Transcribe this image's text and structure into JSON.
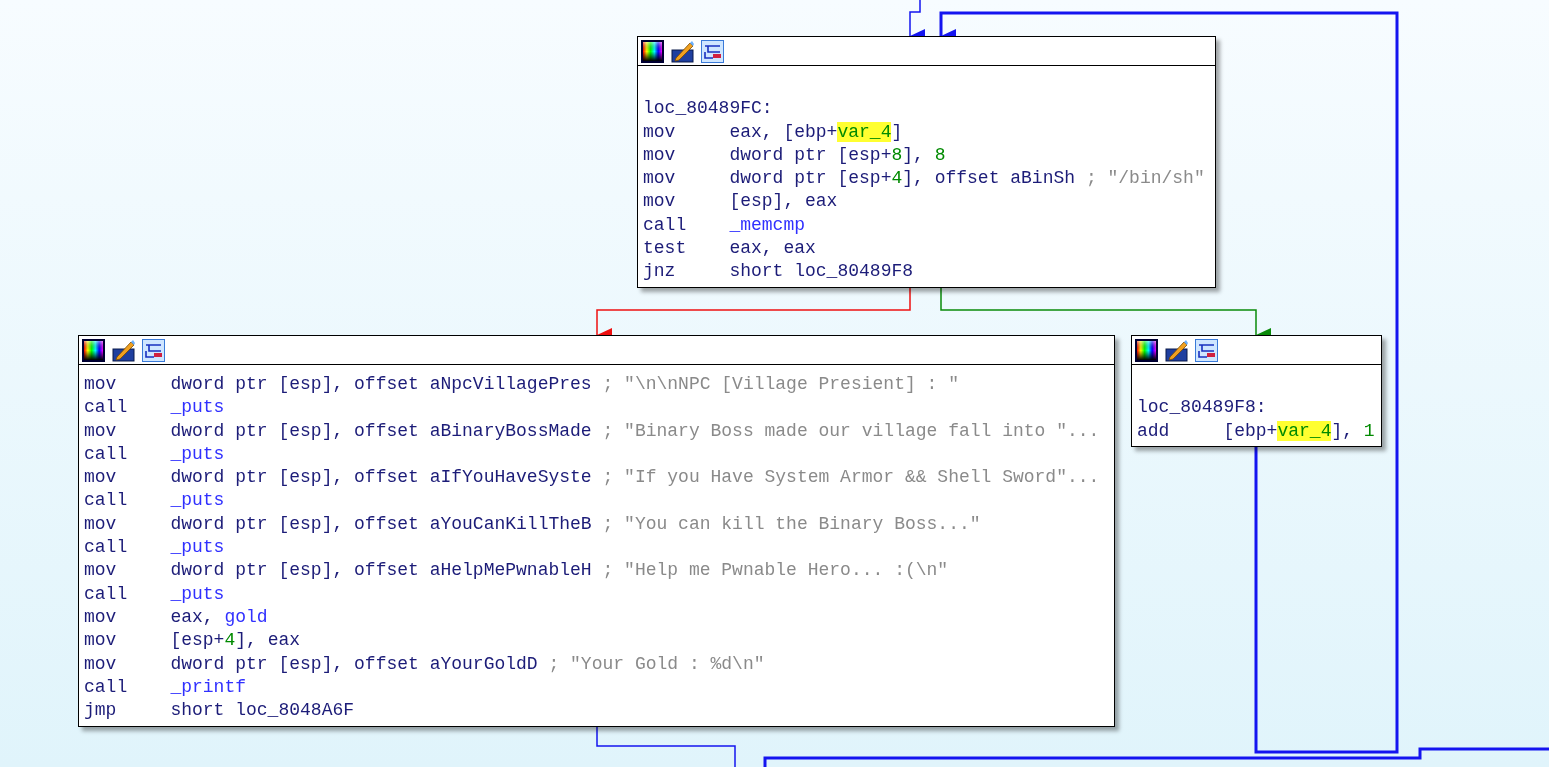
{
  "nodes": [
    {
      "lines": [
        {
          "kind": "blank"
        },
        {
          "kind": "label",
          "text": "loc_80489FC:"
        },
        {
          "kind": "instr",
          "mnemonic": "mov",
          "operands": [
            {
              "kind": "plain",
              "text": "eax, [ebp+"
            },
            {
              "kind": "var",
              "text": "var_4"
            },
            {
              "kind": "plain",
              "text": "]"
            }
          ]
        },
        {
          "kind": "instr",
          "mnemonic": "mov",
          "operands": [
            {
              "kind": "plain",
              "text": "dword ptr [esp+"
            },
            {
              "kind": "num",
              "text": "8"
            },
            {
              "kind": "plain",
              "text": "], "
            },
            {
              "kind": "num",
              "text": "8"
            }
          ]
        },
        {
          "kind": "instr",
          "mnemonic": "mov",
          "operands": [
            {
              "kind": "plain",
              "text": "dword ptr [esp+"
            },
            {
              "kind": "num",
              "text": "4"
            },
            {
              "kind": "plain",
              "text": "], offset aBinSh"
            }
          ],
          "comment": "; \"/bin/sh\""
        },
        {
          "kind": "instr",
          "mnemonic": "mov",
          "operands": [
            {
              "kind": "plain",
              "text": "[esp], eax"
            }
          ]
        },
        {
          "kind": "instr",
          "mnemonic": "call",
          "operands": [
            {
              "kind": "name",
              "text": "_memcmp"
            }
          ]
        },
        {
          "kind": "instr",
          "mnemonic": "test",
          "operands": [
            {
              "kind": "plain",
              "text": "eax, eax"
            }
          ]
        },
        {
          "kind": "instr",
          "mnemonic": "jnz",
          "operands": [
            {
              "kind": "plain",
              "text": "short loc_80489F8"
            }
          ]
        }
      ]
    },
    {
      "lines": [
        {
          "kind": "instr",
          "mnemonic": "mov",
          "operands": [
            {
              "kind": "plain",
              "text": "dword ptr [esp], offset aNpcVillagePres"
            }
          ],
          "comment": "; \"\\n\\nNPC [Village Presient] : \""
        },
        {
          "kind": "instr",
          "mnemonic": "call",
          "operands": [
            {
              "kind": "name",
              "text": "_puts"
            }
          ]
        },
        {
          "kind": "instr",
          "mnemonic": "mov",
          "operands": [
            {
              "kind": "plain",
              "text": "dword ptr [esp], offset aBinaryBossMade"
            }
          ],
          "comment": "; \"Binary Boss made our village fall into \"..."
        },
        {
          "kind": "instr",
          "mnemonic": "call",
          "operands": [
            {
              "kind": "name",
              "text": "_puts"
            }
          ]
        },
        {
          "kind": "instr",
          "mnemonic": "mov",
          "operands": [
            {
              "kind": "plain",
              "text": "dword ptr [esp], offset aIfYouHaveSyste"
            }
          ],
          "comment": "; \"If you Have System Armor && Shell Sword\"..."
        },
        {
          "kind": "instr",
          "mnemonic": "call",
          "operands": [
            {
              "kind": "name",
              "text": "_puts"
            }
          ]
        },
        {
          "kind": "instr",
          "mnemonic": "mov",
          "operands": [
            {
              "kind": "plain",
              "text": "dword ptr [esp], offset aYouCanKillTheB"
            }
          ],
          "comment": "; \"You can kill the Binary Boss...\""
        },
        {
          "kind": "instr",
          "mnemonic": "call",
          "operands": [
            {
              "kind": "name",
              "text": "_puts"
            }
          ]
        },
        {
          "kind": "instr",
          "mnemonic": "mov",
          "operands": [
            {
              "kind": "plain",
              "text": "dword ptr [esp], offset aHelpMePwnableH"
            }
          ],
          "comment": "; \"Help me Pwnable Hero... :(\\n\""
        },
        {
          "kind": "instr",
          "mnemonic": "call",
          "operands": [
            {
              "kind": "name",
              "text": "_puts"
            }
          ]
        },
        {
          "kind": "instr",
          "mnemonic": "mov",
          "operands": [
            {
              "kind": "plain",
              "text": "eax, "
            },
            {
              "kind": "name",
              "text": "gold"
            }
          ]
        },
        {
          "kind": "instr",
          "mnemonic": "mov",
          "operands": [
            {
              "kind": "plain",
              "text": "[esp+"
            },
            {
              "kind": "num",
              "text": "4"
            },
            {
              "kind": "plain",
              "text": "], eax"
            }
          ]
        },
        {
          "kind": "instr",
          "mnemonic": "mov",
          "operands": [
            {
              "kind": "plain",
              "text": "dword ptr [esp], offset aYourGoldD"
            }
          ],
          "comment": "; \"Your Gold : %d\\n\""
        },
        {
          "kind": "instr",
          "mnemonic": "call",
          "operands": [
            {
              "kind": "name",
              "text": "_printf"
            }
          ]
        },
        {
          "kind": "instr",
          "mnemonic": "jmp",
          "operands": [
            {
              "kind": "plain",
              "text": "short loc_8048A6F"
            }
          ]
        }
      ]
    },
    {
      "lines": [
        {
          "kind": "blank"
        },
        {
          "kind": "label",
          "text": "loc_80489F8:"
        },
        {
          "kind": "instr",
          "mnemonic": "add",
          "operands": [
            {
              "kind": "plain",
              "text": "[ebp+"
            },
            {
              "kind": "var",
              "text": "var_4"
            },
            {
              "kind": "plain",
              "text": "], "
            },
            {
              "kind": "num",
              "text": "1"
            }
          ]
        }
      ]
    }
  ]
}
